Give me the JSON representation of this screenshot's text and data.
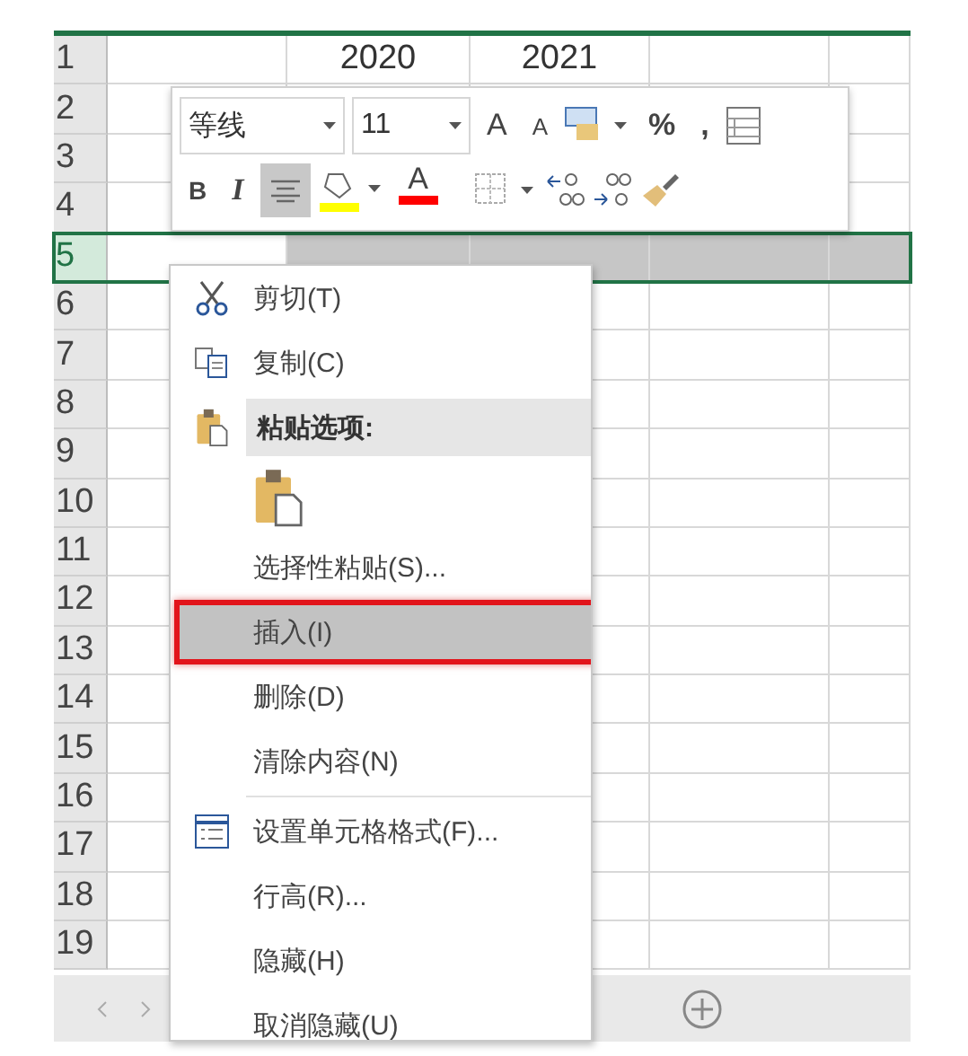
{
  "sheet": {
    "rows": [
      {
        "number": "1",
        "selected": false,
        "cells": [
          null,
          "2020",
          "2021",
          null,
          null
        ]
      },
      {
        "number": "2",
        "selected": false,
        "cells": [
          null,
          null,
          null,
          null,
          null
        ]
      },
      {
        "number": "3",
        "selected": false,
        "cells": [
          null,
          null,
          null,
          null,
          null
        ]
      },
      {
        "number": "4",
        "selected": false,
        "cells": [
          null,
          null,
          null,
          null,
          null
        ]
      },
      {
        "number": "5",
        "selected": true,
        "cells": [
          null,
          null,
          null,
          null,
          null
        ]
      },
      {
        "number": "6",
        "selected": false,
        "cells": [
          null,
          null,
          null,
          null,
          null
        ]
      },
      {
        "number": "7",
        "selected": false,
        "cells": [
          null,
          null,
          null,
          null,
          null
        ]
      },
      {
        "number": "8",
        "selected": false,
        "cells": [
          null,
          null,
          null,
          null,
          null
        ]
      },
      {
        "number": "9",
        "selected": false,
        "cells": [
          null,
          null,
          null,
          null,
          null
        ]
      },
      {
        "number": "10",
        "selected": false,
        "cells": [
          null,
          null,
          null,
          null,
          null
        ]
      },
      {
        "number": "11",
        "selected": false,
        "cells": [
          null,
          null,
          null,
          null,
          null
        ]
      },
      {
        "number": "12",
        "selected": false,
        "cells": [
          null,
          null,
          null,
          null,
          null
        ]
      },
      {
        "number": "13",
        "selected": false,
        "cells": [
          null,
          null,
          null,
          null,
          null
        ]
      },
      {
        "number": "14",
        "selected": false,
        "cells": [
          null,
          null,
          null,
          null,
          null
        ]
      },
      {
        "number": "15",
        "selected": false,
        "cells": [
          null,
          null,
          null,
          null,
          null
        ]
      },
      {
        "number": "16",
        "selected": false,
        "cells": [
          null,
          null,
          null,
          null,
          null
        ]
      },
      {
        "number": "17",
        "selected": false,
        "cells": [
          null,
          null,
          null,
          null,
          null
        ]
      },
      {
        "number": "18",
        "selected": false,
        "cells": [
          null,
          null,
          null,
          null,
          null
        ]
      },
      {
        "number": "19",
        "selected": false,
        "cells": [
          null,
          null,
          null,
          null,
          null
        ]
      }
    ]
  },
  "mini_toolbar": {
    "row_1": [
      {
        "kind": "font",
        "value": "等线"
      },
      {
        "kind": "size",
        "value": "11"
      },
      {
        "kind": "grow",
        "label": "A"
      },
      {
        "kind": "shrink",
        "label": "A"
      },
      {
        "kind": "styles"
      },
      {
        "kind": "text",
        "label": "%"
      },
      {
        "kind": "text",
        "label": ","
      },
      {
        "kind": "table"
      }
    ],
    "row_2": [
      {
        "kind": "bold",
        "label": "B"
      },
      {
        "kind": "italic",
        "label": "I"
      },
      {
        "kind": "align",
        "selected": true
      },
      {
        "kind": "fill",
        "color": "#ffff00"
      },
      {
        "kind": "font_color",
        "label": "A",
        "color": "#ff0000"
      },
      {
        "kind": "border"
      },
      {
        "kind": "inc_decimal"
      },
      {
        "kind": "dec_decimal"
      },
      {
        "kind": "brush"
      }
    ]
  },
  "context_menu": [
    {
      "kind": "cut",
      "label": "剪切(T)",
      "selected": false
    },
    {
      "kind": "copy",
      "label": "复制(C)",
      "selected": false
    },
    {
      "kind": "paste_header",
      "label": "粘贴选项:"
    },
    {
      "kind": "paste_option"
    },
    {
      "kind": "item",
      "label": "选择性粘贴(S)...",
      "selected": false
    },
    {
      "kind": "item",
      "label": "插入(I)",
      "selected": true
    },
    {
      "kind": "item",
      "label": "删除(D)",
      "selected": false
    },
    {
      "kind": "item",
      "label": "清除内容(N)",
      "selected": false
    },
    {
      "kind": "separator"
    },
    {
      "kind": "format",
      "label": "设置单元格格式(F)...",
      "selected": false
    },
    {
      "kind": "item",
      "label": "行高(R)...",
      "selected": false
    },
    {
      "kind": "item",
      "label": "隐藏(H)",
      "selected": false
    },
    {
      "kind": "item",
      "label": "取消隐藏(U)",
      "selected": false
    }
  ]
}
